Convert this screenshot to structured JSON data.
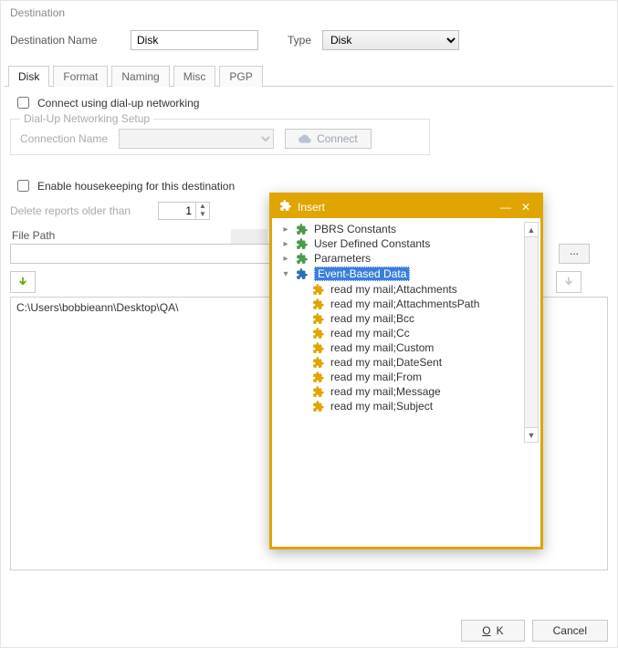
{
  "window": {
    "title": "Destination"
  },
  "fields": {
    "dest_name_label": "Destination Name",
    "dest_name_value": "Disk",
    "type_label": "Type",
    "type_value": "Disk"
  },
  "tabs": [
    "Disk",
    "Format",
    "Naming",
    "Misc",
    "PGP"
  ],
  "dialup": {
    "checkbox_label": "Connect using dial-up networking",
    "group_title": "Dial-Up Networking Setup",
    "conn_name_label": "Connection Name",
    "connect_btn": "Connect"
  },
  "housekeeping": {
    "checkbox_label": "Enable housekeeping for this destination",
    "delete_label": "Delete reports older than",
    "delete_value": "1"
  },
  "filepath": {
    "label": "File Path",
    "browse": "...",
    "list_item": "C:\\Users\\bobbieann\\Desktop\\QA\\"
  },
  "footer": {
    "ok": "OK",
    "cancel": "Cancel"
  },
  "popup": {
    "title": "Insert",
    "roots": [
      "PBRS Constants",
      "User Defined Constants",
      "Parameters",
      "Event-Based Data"
    ],
    "children": [
      "read my mail;Attachments",
      "read my mail;AttachmentsPath",
      "read my mail;Bcc",
      "read my mail;Cc",
      "read my mail;Custom",
      "read my mail;DateSent",
      "read my mail;From",
      "read my mail;Message",
      "read my mail;Subject"
    ]
  }
}
